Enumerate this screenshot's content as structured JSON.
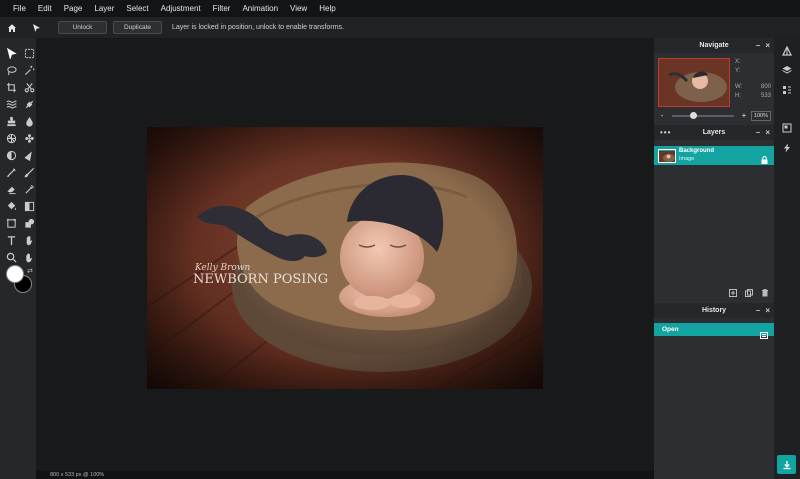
{
  "menu": [
    "File",
    "Edit",
    "Page",
    "Layer",
    "Select",
    "Adjustment",
    "Filter",
    "Animation",
    "View",
    "Help"
  ],
  "toolbar": {
    "unlock_label": "Unlock",
    "duplicate_label": "Duplicate",
    "message": "Layer is locked in position, unlock to enable transforms."
  },
  "canvas": {
    "watermark_signature": "Kelly Brown",
    "watermark_title": "NEWBORN POSING"
  },
  "status": {
    "text": "800 x 533 px @ 100%"
  },
  "navigate": {
    "title": "Navigate",
    "x_label": "X:",
    "y_label": "Y:",
    "w_label": "W:",
    "w_value": "800",
    "h_label": "H:",
    "h_value": "533",
    "zoom_minus": "-",
    "zoom_plus": "+",
    "zoom_value": "100%",
    "zoom_fraction": 0.35
  },
  "layers": {
    "title": "Layers",
    "dots": "•••",
    "items": [
      {
        "name": "Background",
        "type": "Image"
      }
    ]
  },
  "history": {
    "title": "History",
    "items": [
      {
        "label": "Open"
      }
    ]
  },
  "panel_controls": {
    "collapse": "–",
    "close": "×"
  },
  "colors": {
    "accent": "#13a3a0",
    "foreground": "#ffffff",
    "background": "#000000"
  },
  "icons": {
    "tools": [
      "move-icon",
      "marquee-icon",
      "lasso-icon",
      "magic-wand-icon",
      "crop-icon",
      "scissors-icon",
      "liquify-icon",
      "healing-icon",
      "clone-stamp-icon",
      "blur-drop-icon",
      "sponge-icon",
      "pattern-icon",
      "dodge-icon",
      "sharpen-icon",
      "pen-icon",
      "brush-icon",
      "eraser-icon",
      "color-replace-icon",
      "bucket-icon",
      "gradient-icon",
      "frame-icon",
      "shape-icon",
      "text-icon",
      "hand-icon",
      "zoom-icon",
      "pan-hand-icon"
    ]
  }
}
